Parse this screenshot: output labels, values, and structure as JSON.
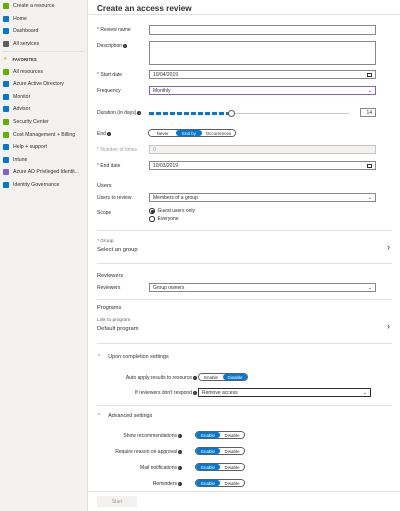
{
  "sidebar": {
    "items_top": [
      {
        "label": "Create a resource",
        "icon": "plus-icon",
        "color": "#5db300"
      },
      {
        "label": "Home",
        "icon": "home-icon",
        "color": "#0078d4"
      },
      {
        "label": "Dashboard",
        "icon": "dashboard-icon",
        "color": "#0078d4"
      },
      {
        "label": "All services",
        "icon": "list-icon",
        "color": "#605e5c"
      }
    ],
    "favorites_label": "FAVORITES",
    "items_fav": [
      {
        "label": "All resources",
        "icon": "grid-icon",
        "color": "#5db300"
      },
      {
        "label": "Azure Active Directory",
        "icon": "aad-icon",
        "color": "#0078d4"
      },
      {
        "label": "Monitor",
        "icon": "monitor-icon",
        "color": "#0078d4"
      },
      {
        "label": "Advisor",
        "icon": "advisor-icon",
        "color": "#0078d4"
      },
      {
        "label": "Security Center",
        "icon": "shield-icon",
        "color": "#5db300"
      },
      {
        "label": "Cost Management + Billing",
        "icon": "cost-icon",
        "color": "#5db300"
      },
      {
        "label": "Help + support",
        "icon": "help-icon",
        "color": "#0078d4"
      },
      {
        "label": "Intune",
        "icon": "intune-icon",
        "color": "#0078d4"
      },
      {
        "label": "Azure AD Privileged Identit...",
        "icon": "pim-icon",
        "color": "#8661c5"
      },
      {
        "label": "Identity Governance",
        "icon": "governance-icon",
        "color": "#0078d4"
      }
    ]
  },
  "page": {
    "title": "Create an access review",
    "review_name_label": "Review name",
    "description_label": "Description",
    "start_date_label": "Start date",
    "start_date_value": "10/04/2019",
    "frequency_label": "Frequency",
    "frequency_value": "Monthly",
    "duration_label": "Duration (in days)",
    "duration_value": "14",
    "duration_fraction": 0.41,
    "end_label": "End",
    "end_options": [
      "Never",
      "End by",
      "Occurrences"
    ],
    "end_selected": "End by",
    "num_times_label": "Number of times",
    "num_times_value": "0",
    "end_date_label": "End date",
    "end_date_value": "10/03/2019",
    "users_heading": "Users",
    "users_to_review_label": "Users to review",
    "users_to_review_value": "Members of a group",
    "scope_label": "Scope",
    "scope_options": [
      "Guest users only",
      "Everyone"
    ],
    "scope_selected": "Guest users only",
    "group_label": "Group",
    "group_value": "Select an group",
    "reviewers_heading": "Reviewers",
    "reviewers_label": "Reviewers",
    "reviewers_value": "Group owners",
    "programs_heading": "Programs",
    "link_program_label": "Link to program",
    "link_program_value": "Default program",
    "completion_heading": "Upon completion settings",
    "auto_apply_label": "Auto apply results to resource",
    "auto_apply_options": [
      "Enable",
      "Disable"
    ],
    "auto_apply_selected": "Disable",
    "no_respond_label": "If reviewers don't respond",
    "no_respond_value": "Remove access",
    "advanced_heading": "Advanced settings",
    "show_rec_label": "Show recommendations",
    "require_reason_label": "Require reason on approval",
    "mail_label": "Mail notifications",
    "reminders_label": "Reminders",
    "enable_label": "Enable",
    "disable_label": "Disable",
    "start_button": "Start"
  }
}
